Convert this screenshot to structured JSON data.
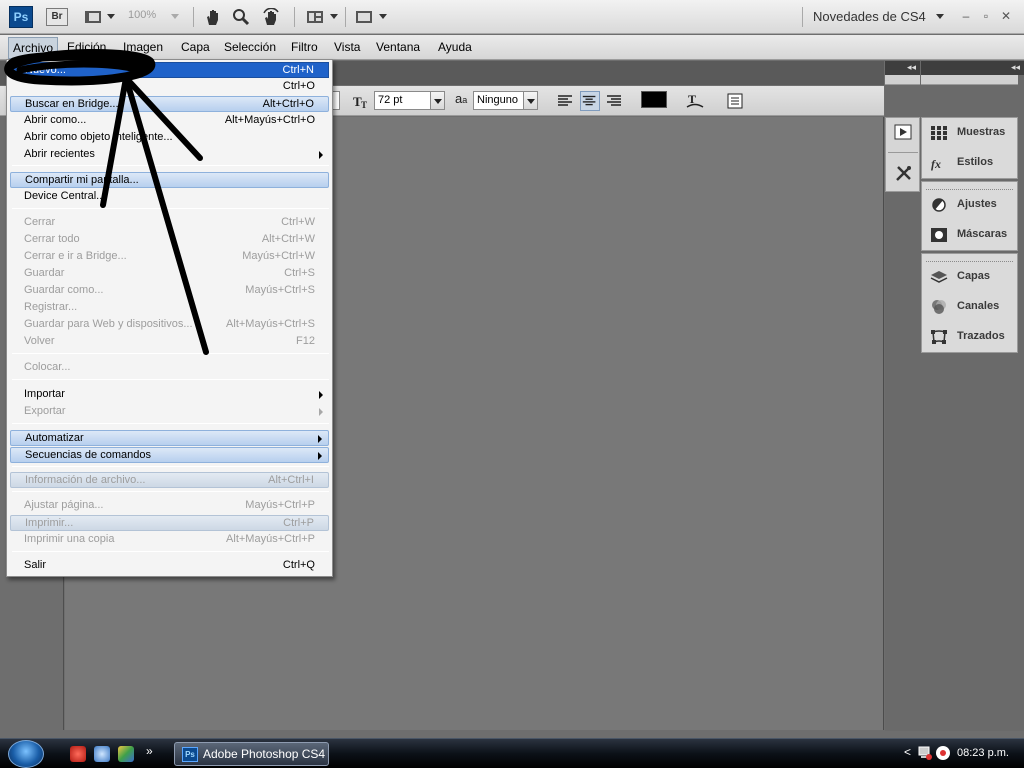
{
  "app_bar": {
    "logo": "Ps",
    "bridge": "Br",
    "zoom": "100%",
    "workspace": "Novedades de CS4",
    "window_controls": [
      "–",
      "▫",
      "✕"
    ],
    "icons": [
      "launch-bridge",
      "view-extras",
      "hand-tool",
      "zoom-tool",
      "rotate-view-tool",
      "arrange-documents",
      "screen-mode"
    ]
  },
  "menu_bar": {
    "items": [
      "Archivo",
      "Edición",
      "Imagen",
      "Capa",
      "Selección",
      "Filtro",
      "Vista",
      "Ventana",
      "Ayuda"
    ]
  },
  "options_bar": {
    "font_size": "72 pt",
    "antialias_icon_text": "a",
    "antialias_icon_text_small": "a",
    "antialias": "Ninguno",
    "text_color": "#000000"
  },
  "dropdown": {
    "items": [
      {
        "label": "Nuevo...",
        "shortcut": "Ctrl+N",
        "state": "selected"
      },
      {
        "label": "",
        "shortcut": "Ctrl+O",
        "state": "normal"
      },
      {
        "label": "Buscar en Bridge...",
        "shortcut": "Alt+Ctrl+O",
        "state": "highlight"
      },
      {
        "label": "Abrir como...",
        "shortcut": "Alt+Mayús+Ctrl+O",
        "state": "normal"
      },
      {
        "label": "Abrir como objeto inteligente...",
        "shortcut": "",
        "state": "normal"
      },
      {
        "label": "Abrir recientes",
        "shortcut": "",
        "state": "normal",
        "submenu": true
      },
      {
        "label": "Compartir mi pantalla...",
        "shortcut": "",
        "state": "highlight"
      },
      {
        "label": "Device Central...",
        "shortcut": "",
        "state": "normal"
      },
      {
        "label": "Cerrar",
        "shortcut": "Ctrl+W",
        "state": "disabled"
      },
      {
        "label": "Cerrar todo",
        "shortcut": "Alt+Ctrl+W",
        "state": "disabled"
      },
      {
        "label": "Cerrar e ir a Bridge...",
        "shortcut": "Mayús+Ctrl+W",
        "state": "disabled"
      },
      {
        "label": "Guardar",
        "shortcut": "Ctrl+S",
        "state": "disabled"
      },
      {
        "label": "Guardar como...",
        "shortcut": "Mayús+Ctrl+S",
        "state": "disabled"
      },
      {
        "label": "Registrar...",
        "shortcut": "",
        "state": "disabled"
      },
      {
        "label": "Guardar para Web y dispositivos...",
        "shortcut": "Alt+Mayús+Ctrl+S",
        "state": "disabled"
      },
      {
        "label": "Volver",
        "shortcut": "F12",
        "state": "disabled"
      },
      {
        "label": "Colocar...",
        "shortcut": "",
        "state": "disabled"
      },
      {
        "label": "Importar",
        "shortcut": "",
        "state": "normal",
        "submenu": true
      },
      {
        "label": "Exportar",
        "shortcut": "",
        "state": "disabled",
        "submenu": true
      },
      {
        "label": "Automatizar",
        "shortcut": "",
        "state": "highlight",
        "submenu": true
      },
      {
        "label": "Secuencias de comandos",
        "shortcut": "",
        "state": "highlight",
        "submenu": true
      },
      {
        "label": "Información de archivo...",
        "shortcut": "Alt+Ctrl+I",
        "state": "disabled-highlight"
      },
      {
        "label": "Ajustar página...",
        "shortcut": "Mayús+Ctrl+P",
        "state": "disabled"
      },
      {
        "label": "Imprimir...",
        "shortcut": "Ctrl+P",
        "state": "disabled-highlight"
      },
      {
        "label": "Imprimir una copia",
        "shortcut": "Alt+Mayús+Ctrl+P",
        "state": "disabled"
      },
      {
        "label": "Salir",
        "shortcut": "Ctrl+Q",
        "state": "normal"
      }
    ]
  },
  "panels": {
    "group1": [
      "Muestras",
      "Estilos"
    ],
    "group2": [
      "Ajustes",
      "Máscaras"
    ],
    "group3": [
      "Capas",
      "Canales",
      "Trazados"
    ],
    "collapse_arrows": [
      "◂◂",
      "◂◂"
    ]
  },
  "taskbar": {
    "task_label": "Adobe Photoshop CS4",
    "task_icon": "Ps",
    "overflow": "»",
    "tray_arrow": "<",
    "clock": "08:23 p.m."
  }
}
